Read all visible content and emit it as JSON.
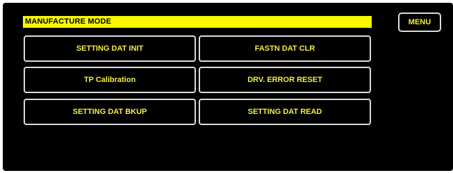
{
  "header": {
    "title": "MANUFACTURE MODE",
    "menu_label": "MENU"
  },
  "buttons": {
    "setting_dat_init": "SETTING DAT INIT",
    "fastn_dat_clr": "FASTN DAT CLR",
    "tp_calibration": "TP Calibration",
    "drv_error_reset": "DRV. ERROR RESET",
    "setting_dat_bkup": "SETTING DAT BKUP",
    "setting_dat_read": "SETTING DAT READ"
  },
  "colors": {
    "panel_background": "#000000",
    "title_bar": "#f8f800",
    "button_text": "#f3ef3b",
    "button_border": "#dcdcdc"
  }
}
